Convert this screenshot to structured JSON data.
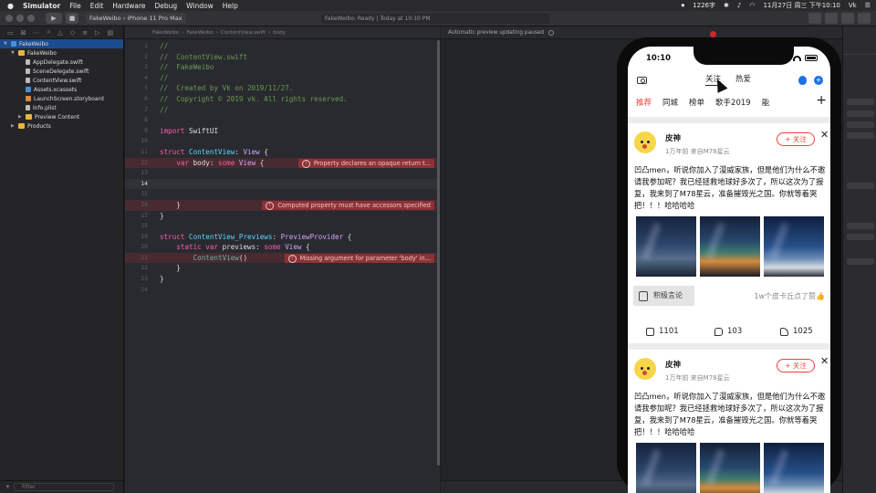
{
  "menubar": {
    "apple": "",
    "app_name": "Simulator",
    "items": [
      "File",
      "Edit",
      "Hardware",
      "Debug",
      "Window",
      "Help"
    ],
    "battery": "1226字",
    "datetime": "11月27日 周三 下午10:10",
    "user": "Vk"
  },
  "toolbar": {
    "scheme": "FakeWeibo",
    "device": "iPhone 11 Pro Max",
    "status": "FakeWeibo: Ready | Today at 10:10 PM"
  },
  "navigator": {
    "filter_placeholder": "Filter",
    "tree": [
      {
        "name": "FakeWeibo",
        "kind": "project",
        "depth": 0
      },
      {
        "name": "FakeWeibo",
        "kind": "folder",
        "depth": 1
      },
      {
        "name": "AppDelegate.swift",
        "kind": "file",
        "depth": 2
      },
      {
        "name": "SceneDelegate.swift",
        "kind": "file",
        "depth": 2
      },
      {
        "name": "ContentView.swift",
        "kind": "file",
        "depth": 2
      },
      {
        "name": "Assets.xcassets",
        "kind": "asset",
        "depth": 2
      },
      {
        "name": "LaunchScreen.storyboard",
        "kind": "storyboard",
        "depth": 2
      },
      {
        "name": "Info.plist",
        "kind": "file",
        "depth": 2
      },
      {
        "name": "Preview Content",
        "kind": "folder",
        "depth": 2
      },
      {
        "name": "Products",
        "kind": "folder",
        "depth": 1
      }
    ]
  },
  "editor": {
    "jumpbar": [
      "FakeWeibo",
      "FakeWeibo",
      "ContentView.swift",
      "body"
    ],
    "lines": [
      {
        "n": "1",
        "html": "<span class='cm'>//</span>"
      },
      {
        "n": "2",
        "html": "<span class='cm'>//  ContentView.swift</span>"
      },
      {
        "n": "3",
        "html": "<span class='cm'>//  FakeWeibo</span>"
      },
      {
        "n": "4",
        "html": "<span class='cm'>//</span>"
      },
      {
        "n": "5",
        "html": "<span class='cm'>//  Created by Vk on 2019/11/27.</span>"
      },
      {
        "n": "6",
        "html": "<span class='cm'>//  Copyright © 2019 vk. All rights reserved.</span>"
      },
      {
        "n": "7",
        "html": "<span class='cm'>//</span>"
      },
      {
        "n": "8",
        "html": ""
      },
      {
        "n": "9",
        "html": "<span class='kw'>import</span> SwiftUI"
      },
      {
        "n": "10",
        "html": ""
      },
      {
        "n": "11",
        "html": "<span class='kw'>struct</span> <span class='ty'>ContentView</span>: <span class='tp'>View</span> {"
      },
      {
        "n": "12",
        "html": "    <span class='kw'>var</span> body: <span class='kw'>some</span> <span class='tp'>View</span> {",
        "error": "Property declares an opaque return t..."
      },
      {
        "n": "13",
        "html": ""
      },
      {
        "n": "14",
        "html": "",
        "current": true
      },
      {
        "n": "15",
        "html": ""
      },
      {
        "n": "16",
        "html": "    }",
        "error": "Computed property must have accessors specified"
      },
      {
        "n": "17",
        "html": "}"
      },
      {
        "n": "18",
        "html": ""
      },
      {
        "n": "19",
        "html": "<span class='kw'>struct</span> <span class='ty'>ContentView_Previews</span>: <span class='tp'>PreviewProvider</span> {"
      },
      {
        "n": "20",
        "html": "    <span class='kw'>static var</span> previews: <span class='kw'>some</span> <span class='tp'>View</span> {"
      },
      {
        "n": "21",
        "html": "        <span class='fn'>ContentView</span>()",
        "error": "Missing argument for parameter 'body' in..."
      },
      {
        "n": "22",
        "html": "    }"
      },
      {
        "n": "23",
        "html": "}"
      },
      {
        "n": "24",
        "html": ""
      }
    ]
  },
  "canvas": {
    "notice": "Automatic preview updating paused"
  },
  "phone": {
    "time": "10:10",
    "top_tabs": [
      "关注",
      "热爱"
    ],
    "channels": [
      "推荐",
      "同城",
      "榜单",
      "歌手2019",
      "能"
    ],
    "posts": [
      {
        "user": "皮神",
        "meta": "1万年前 来自M78星云",
        "follow": "+ 关注",
        "text": "凹凸men，听说你加入了漫威家族，但是他们为什么不邀请我参加呢？我已经拯救地球好多次了，所以这次为了报复，我来到了M78星云，准备摧毁光之国。你就等着哭把！！！哈哈哈哈",
        "badge": "积极言论",
        "likes_note": "1w个皮卡丘点了赞👍",
        "reposts": "1101",
        "comments": "103",
        "likes": "1025"
      },
      {
        "user": "皮神",
        "meta": "1万年前 来自M78星云",
        "follow": "+ 关注",
        "text": "凹凸men，听说你加入了漫威家族，但是他们为什么不邀请我参加呢？我已经拯救地球好多次了，所以这次为了报复，我来到了M78星云，准备摧毁光之国。你就等着哭把！！！哈哈哈哈"
      }
    ]
  }
}
